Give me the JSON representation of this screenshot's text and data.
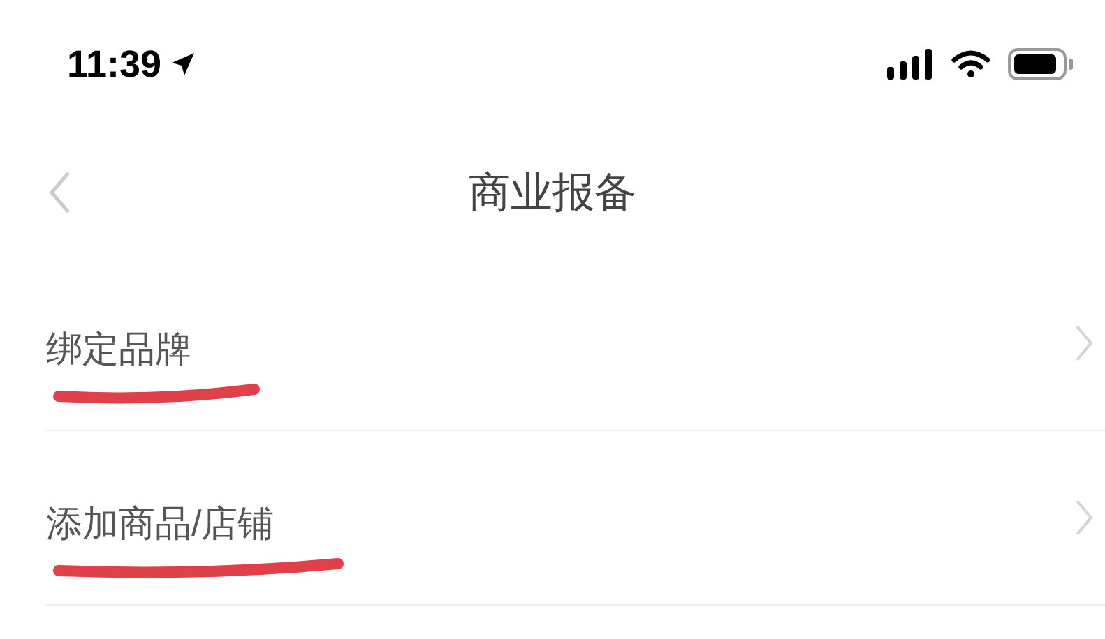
{
  "status_bar": {
    "time": "11:39"
  },
  "nav": {
    "title": "商业报备"
  },
  "rows": [
    {
      "label": "绑定品牌"
    },
    {
      "label": "添加商品/店铺"
    }
  ]
}
